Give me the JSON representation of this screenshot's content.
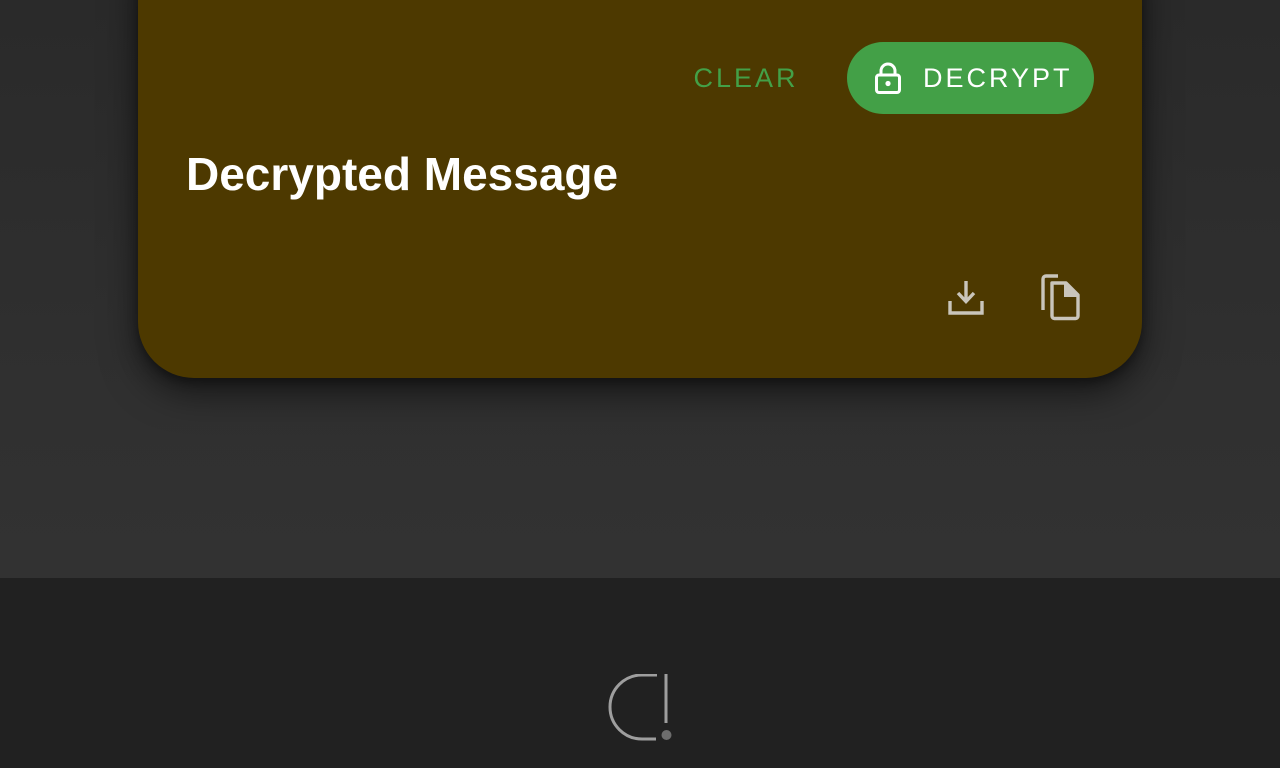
{
  "card": {
    "background_color": "#4d3900",
    "clear_label": "CLEAR",
    "decrypt_label": "DECRYPT",
    "decrypt_icon": "lock-icon",
    "title": "Decrypted Message",
    "actions": [
      {
        "icon": "download-icon"
      },
      {
        "icon": "copy-icon"
      }
    ]
  },
  "colors": {
    "accent": "#43a047",
    "footer_bg": "#212121",
    "icon_gray": "#c9c5bb",
    "logo_gray": "#9e9e9e"
  },
  "footer": {
    "logo_icon": "app-logo-icon"
  }
}
